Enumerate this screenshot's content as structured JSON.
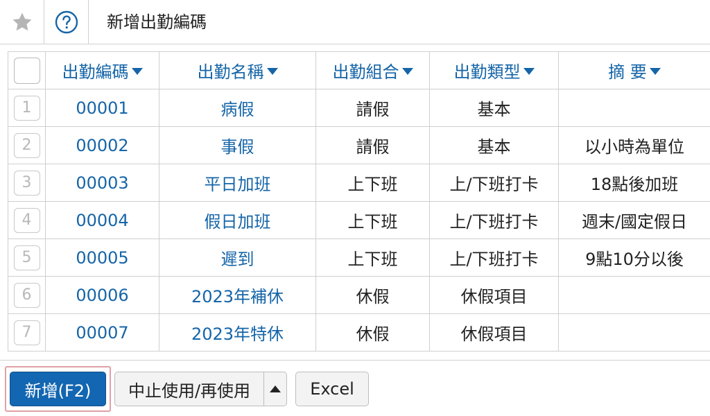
{
  "header": {
    "title": "新增出勤編碼",
    "favorite_icon": "star-icon",
    "help_icon": "question-circle-icon"
  },
  "table": {
    "columns": [
      "出勤編碼",
      "出勤名稱",
      "出勤組合",
      "出勤類型",
      "摘 要"
    ],
    "rows": [
      {
        "num": "1",
        "code": "00001",
        "name": "病假",
        "group": "請假",
        "type": "基本",
        "summary": ""
      },
      {
        "num": "2",
        "code": "00002",
        "name": "事假",
        "group": "請假",
        "type": "基本",
        "summary": "以小時為單位"
      },
      {
        "num": "3",
        "code": "00003",
        "name": "平日加班",
        "group": "上下班",
        "type": "上/下班打卡",
        "summary": "18點後加班"
      },
      {
        "num": "4",
        "code": "00004",
        "name": "假日加班",
        "group": "上下班",
        "type": "上/下班打卡",
        "summary": "週末/國定假日"
      },
      {
        "num": "5",
        "code": "00005",
        "name": "遲到",
        "group": "上下班",
        "type": "上/下班打卡",
        "summary": "9點10分以後"
      },
      {
        "num": "6",
        "code": "00006",
        "name": "2023年補休",
        "group": "休假",
        "type": "休假項目",
        "summary": ""
      },
      {
        "num": "7",
        "code": "00007",
        "name": "2023年特休",
        "group": "休假",
        "type": "休假項目",
        "summary": ""
      }
    ]
  },
  "footer": {
    "add_label": "新增(F2)",
    "stop_label": "中止使用/再使用",
    "excel_label": "Excel"
  },
  "colors": {
    "link": "#1565a8",
    "primary_button": "#1366b1",
    "highlight_frame": "#e0a0a6"
  }
}
